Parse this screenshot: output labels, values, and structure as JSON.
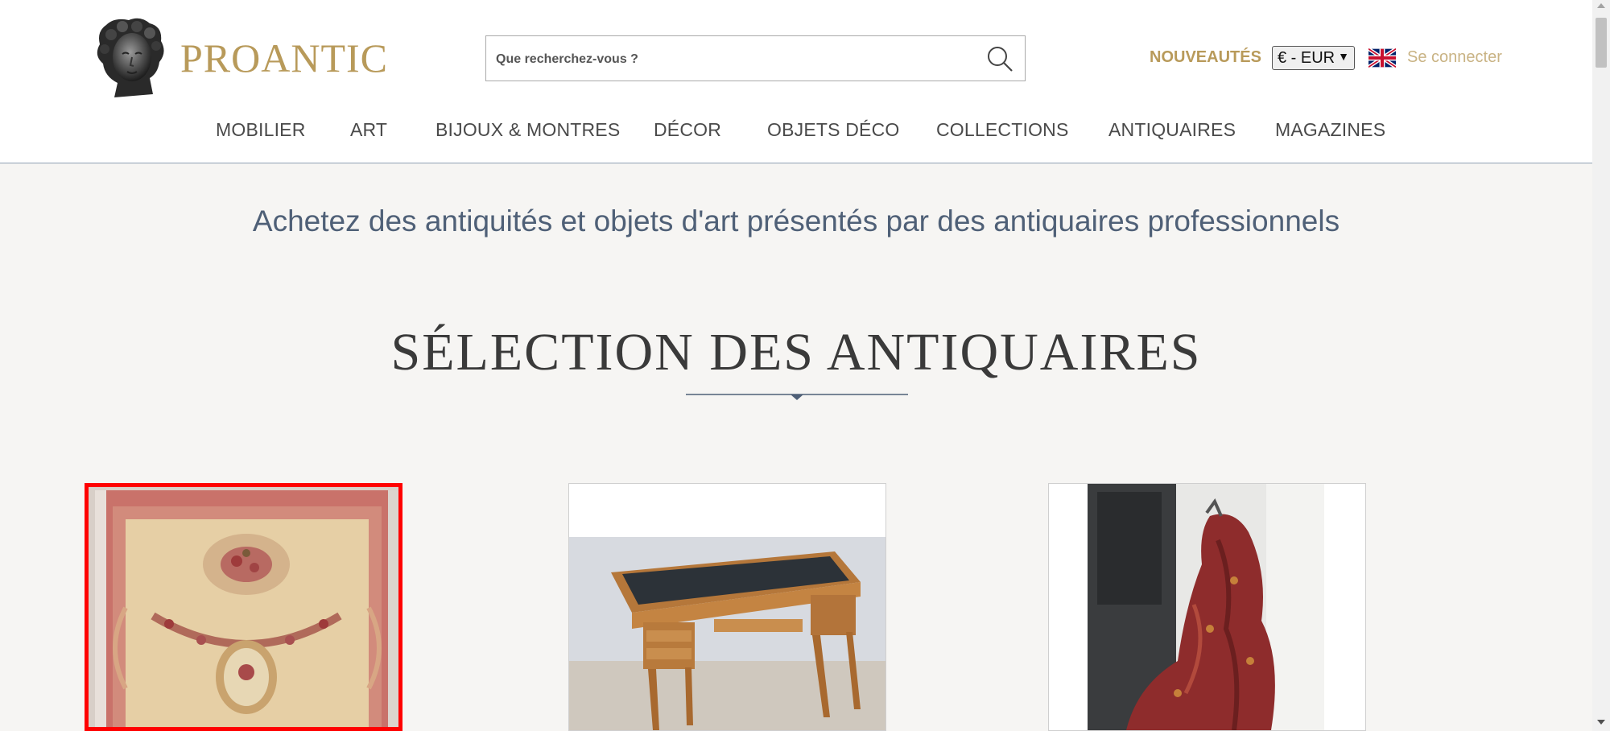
{
  "header": {
    "brand": "PROANTIC",
    "search_placeholder": "Que recherchez-vous ?",
    "nouveautes": "NOUVEAUTÉS",
    "currency": "€ - EUR",
    "login": "Se connecter"
  },
  "nav": [
    "MOBILIER",
    "ART",
    "BIJOUX & MONTRES",
    "DÉCOR",
    "OBJETS DÉCO",
    "COLLECTIONS",
    "ANTIQUAIRES",
    "MAGAZINES"
  ],
  "tagline": "Achetez des antiquités et objets d'art présentés par des antiquaires professionnels",
  "section": {
    "title": "SÉLECTION DES ANTIQUAIRES"
  },
  "colors": {
    "gold": "#b89a5a",
    "slate": "#4f6077",
    "selected_border": "#ff0000"
  },
  "icons": [
    "search-icon",
    "uk-flag-icon",
    "bust-logo"
  ]
}
